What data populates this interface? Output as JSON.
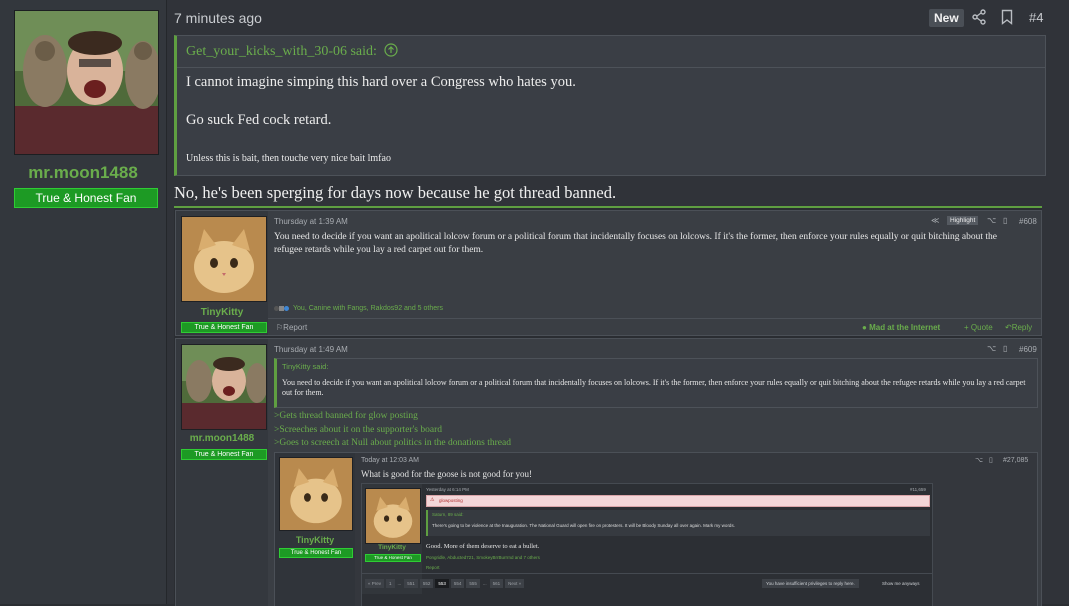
{
  "post": {
    "author": "mr.moon1488",
    "user_title": "True & Honest Fan",
    "time": "7 minutes ago",
    "new_badge": "New",
    "number": "#4",
    "quote": {
      "author_line": "Get_your_kicks_with_30-06 said:",
      "line1": "I cannot imagine simping this hard over a Congress who hates you.",
      "line2": "Go suck Fed cock retard.",
      "line3": "Unless this is bait, then touche very nice bait lmfao"
    },
    "body": "No, he's been sperging for days now because he got thread banned."
  },
  "embed1": {
    "author": "TinyKitty",
    "user_title": "True & Honest Fan",
    "time": "Thursday at 1:39 AM",
    "highlight": "Highlight",
    "number": "#608",
    "text": "You need to decide if you want an apolitical lolcow forum or a political forum that incidentally focuses on lolcows. If it's the former, then enforce your rules equally or quit bitching about the refugee retards while you lay a red carpet out for them.",
    "reactions": "You, Canine with Fangs, Rakdos92 and 5 others",
    "report": "Report",
    "mad_label": "Mad at the Internet",
    "quote_label": "+ Quote",
    "reply_label": "Reply"
  },
  "embed2": {
    "author": "mr.moon1488",
    "user_title": "True & Honest Fan",
    "time": "Thursday at 1:49 AM",
    "number": "#609",
    "quote_author": "TinyKitty said:",
    "quote_text": "You need to decide if you want an apolitical lolcow forum or a political forum that incidentally focuses on lolcows. If it's the former, then enforce your rules equally or quit bitching about the refugee retards while you lay a red carpet out for them.",
    "greentext": [
      ">Gets thread banned for glow posting",
      ">Screeches about it on the supporter's board",
      ">Goes to screech at Null about politics in the donations thread"
    ]
  },
  "embed3": {
    "author": "TinyKitty",
    "user_title": "True & Honest Fan",
    "time": "Today at 12:03 AM",
    "number": "#27,085",
    "text": "What is good for the goose is not good for you!"
  },
  "embed4": {
    "time": "Yesterday at 6:14 PM",
    "number": "#11,659",
    "warning": "glowposting",
    "quote_author": "Saturn, 89 said:",
    "quote_text": "There's going to be violence at the Inauguration. The National Guard will open fire on protesters. It will be Bloody Sunday all over again. Mark my words.",
    "author": "TinyKitty",
    "user_title": "True & Honest Fan",
    "reply_text": "Good. More of them deserve to eat a bullet.",
    "reactions": "Pongridle, Abducted721, SmokeyBrrBurrrnd and 7 others",
    "report": "Report",
    "pages": [
      "« Prev",
      "1",
      "...",
      "551",
      "552",
      "553",
      "554",
      "555",
      "...",
      "561",
      "Next »"
    ],
    "no_priv": "You have insufficient privileges to reply here.",
    "show_anyway": "Show me anyways"
  }
}
